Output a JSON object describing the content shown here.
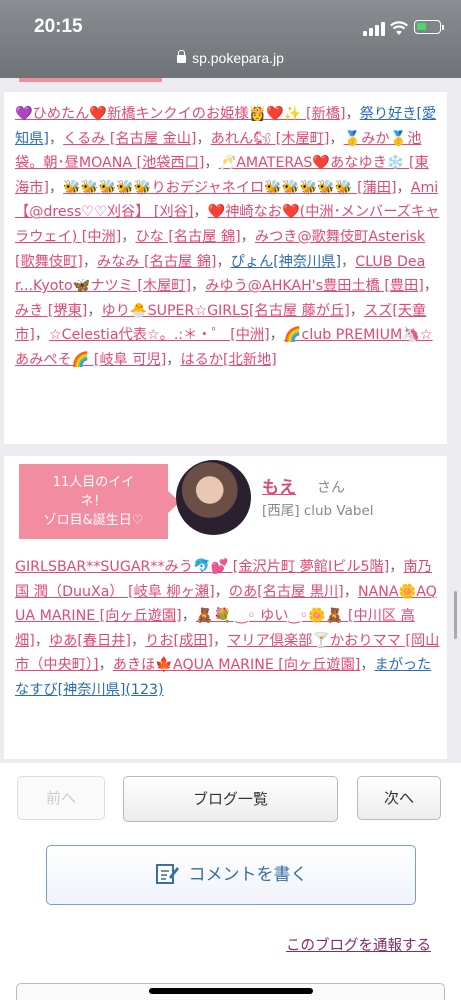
{
  "status": {
    "time": "20:15",
    "url": "sp.pokepara.jp"
  },
  "likes1": [
    {
      "t": "💜ひめたん❤️新橋キンクイのお姫様👸❤️✨ [新橋]",
      "c": "pink"
    },
    {
      "t": "祭り好き[愛知県]",
      "c": "blue"
    },
    {
      "t": "くるみ [名古屋 金山]",
      "c": "pink"
    },
    {
      "t": "あれん🐿 [木屋町]",
      "c": "pink"
    },
    {
      "t": "🥇みか🥇池袋。朝･昼MOANA [池袋西口]",
      "c": "pink"
    },
    {
      "t": "🥂AMATERAS❤️あなゆき❄️ [東海市]",
      "c": "pink"
    },
    {
      "t": "🐝🐝🐝🐝🐝りおデジャネイロ🐝🐝🐝🐝🐝 [蒲田]",
      "c": "pink"
    },
    {
      "t": "Ami【@dress♡♡刈谷】 [刈谷]",
      "c": "pink"
    },
    {
      "t": "❤️神崎なお❤️(中洲･メンバーズキャラウェイ) [中洲]",
      "c": "pink"
    },
    {
      "t": "ひな [名古屋 錦]",
      "c": "pink"
    },
    {
      "t": "みつき@歌舞伎町Asterisk [歌舞伎町]",
      "c": "pink"
    },
    {
      "t": "みなみ [名古屋 錦]",
      "c": "pink"
    },
    {
      "t": "ぴょん[神奈川県]",
      "c": "blue"
    },
    {
      "t": "CLUB Dear...Kyoto🦋ナツミ [木屋町]",
      "c": "pink"
    },
    {
      "t": "みゆう@AHKAH's豊田土橋 [豊田]",
      "c": "pink"
    },
    {
      "t": "みき [堺東]",
      "c": "pink"
    },
    {
      "t": "ゆり🐣SUPER☆GIRLS[名古屋 藤が丘]",
      "c": "pink"
    },
    {
      "t": "スズ[天童市]",
      "c": "pink"
    },
    {
      "t": "☆Celestia代表☆。.:＊・゜ [中洲]",
      "c": "pink"
    },
    {
      "t": "🌈club PREMIUM🦄☆あみぺそ🌈 [岐阜 可児]",
      "c": "pink"
    },
    {
      "t": "はるか[北新地]",
      "c": "pink"
    }
  ],
  "highlight": {
    "badge_line1": "11人目のイイ",
    "badge_line2": "ネ！",
    "badge_line3": "ゾロ目&誕生日♡",
    "name": "もえ",
    "honorific": "さん",
    "place": "[西尾] club Vabel"
  },
  "likes2": [
    {
      "t": "GIRLSBAR**SUGAR**みう🐬💕 [金沢片町 夢館Ⅰビル5階]",
      "c": "pink"
    },
    {
      "t": "南乃国 潤（DuuXa） [岐阜 柳ヶ瀬]",
      "c": "pink"
    },
    {
      "t": "のあ[名古屋 黒川]",
      "c": "pink"
    },
    {
      "t": "NANA🌼AQUA MARINE [向ヶ丘遊園]",
      "c": "pink"
    },
    {
      "t": "🧸💐 ‿◦ ゆい‿◦🌼🧸 [中川区 高畑]",
      "c": "pink"
    },
    {
      "t": "ゆあ[春日井]",
      "c": "pink"
    },
    {
      "t": "りお[成田]",
      "c": "pink"
    },
    {
      "t": "マリア倶楽部🍸かおりママ [岡山市（中央町）]",
      "c": "pink"
    },
    {
      "t": "あきほ🍁AQUA MARINE [向ヶ丘遊園]",
      "c": "pink"
    },
    {
      "t": "まがったなすび[神奈川県]",
      "c": "blue"
    },
    {
      "t": "(123)",
      "c": "blue"
    }
  ],
  "nav": {
    "prev": "前へ",
    "list": "ブログ一覧",
    "next": "次へ",
    "comment": "コメントを書く",
    "report": "このブログを通報する"
  }
}
